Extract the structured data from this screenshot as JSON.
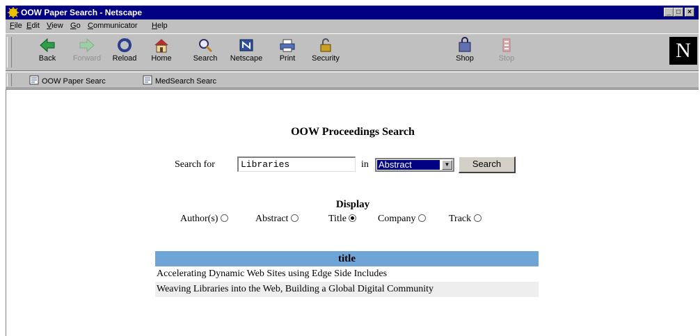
{
  "window": {
    "title": "OOW Paper Search - Netscape",
    "controls": [
      "_",
      "□",
      "×"
    ]
  },
  "menu": [
    {
      "underline": "F",
      "rest": "ile"
    },
    {
      "underline": "E",
      "rest": "dit"
    },
    {
      "underline": "V",
      "rest": "iew"
    },
    {
      "underline": "G",
      "rest": "o"
    },
    {
      "underline": "C",
      "rest": "ommunicator"
    },
    {
      "underline": "H",
      "rest": "elp"
    }
  ],
  "toolbar": {
    "buttons": [
      {
        "label": "Back",
        "icon": "back-arrow-icon",
        "enabled": true
      },
      {
        "label": "Forward",
        "icon": "forward-arrow-icon",
        "enabled": false
      },
      {
        "label": "Reload",
        "icon": "reload-icon",
        "enabled": true
      },
      {
        "label": "Home",
        "icon": "home-icon",
        "enabled": true
      },
      {
        "label": "Search",
        "icon": "search-icon",
        "enabled": true
      },
      {
        "label": "Netscape",
        "icon": "netscape-icon",
        "enabled": true
      },
      {
        "label": "Print",
        "icon": "print-icon",
        "enabled": true
      },
      {
        "label": "Security",
        "icon": "lock-icon",
        "enabled": true
      },
      {
        "label": "Shop",
        "icon": "shop-icon",
        "enabled": true
      },
      {
        "label": "Stop",
        "icon": "stop-icon",
        "enabled": false
      }
    ],
    "logo": "N"
  },
  "bookmarks": [
    {
      "label": "OOW Paper Searc",
      "icon": "bookmark-page-icon"
    },
    {
      "label": "MedSearch Searc",
      "icon": "bookmark-page-icon"
    }
  ],
  "page": {
    "heading": "OOW Proceedings Search",
    "search": {
      "label": "Search for",
      "value": "Libraries",
      "in_label": "in",
      "field": "Abstract",
      "button": "Search"
    },
    "display": {
      "heading": "Display",
      "options": [
        {
          "label": "Author(s)",
          "checked": false
        },
        {
          "label": "Abstract",
          "checked": false
        },
        {
          "label": "Title",
          "checked": true
        },
        {
          "label": "Company",
          "checked": false
        },
        {
          "label": "Track",
          "checked": false
        }
      ]
    },
    "results": {
      "header": "title",
      "rows": [
        "Accelerating Dynamic Web Sites using Edge Side Includes",
        "Weaving Libraries into the Web, Building a Global Digital Community"
      ]
    }
  },
  "colors": {
    "titlebar": "#000080",
    "chrome": "#c0c0c0",
    "table_header": "#6fa4d6",
    "alt_row": "#eeeeee"
  }
}
